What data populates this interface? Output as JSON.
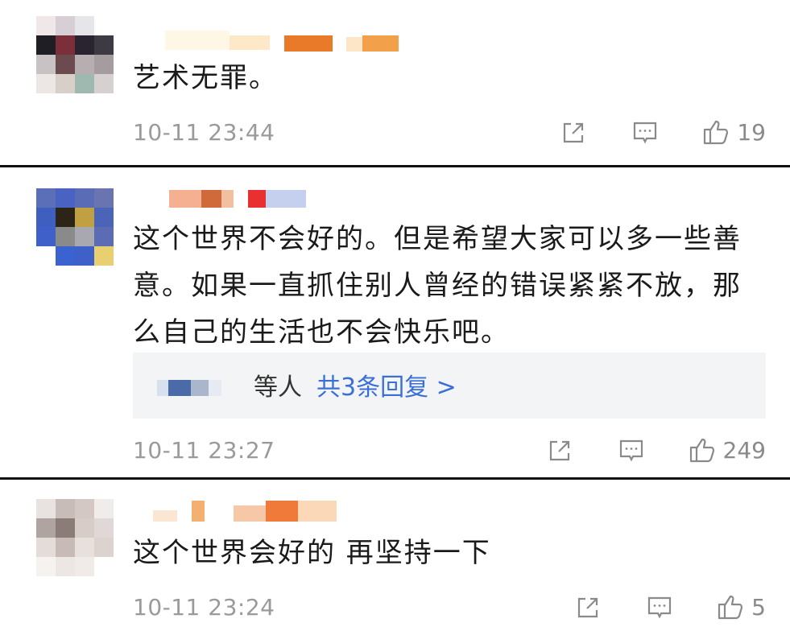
{
  "comments": [
    {
      "text": "艺术无罪。",
      "time": "10-11 23:44",
      "likes": "19"
    },
    {
      "text": "这个世界不会好的。但是希望大家可以多一些善意。如果一直抓住别人曾经的错误紧紧不放，那么自己的生活也不会快乐吧。",
      "time": "10-11 23:27",
      "likes": "249",
      "reply_prefix": "等人",
      "reply_link": "共3条回复 >"
    },
    {
      "text": "这个世界会好的 再坚持一下",
      "time": "10-11 23:24",
      "likes": "5"
    }
  ],
  "icons": {
    "share": "share-icon",
    "comment": "comment-icon",
    "like": "thumbs-up-icon"
  },
  "colors": {
    "link": "#3a6fd8",
    "meta": "#9a9a9a",
    "reply_bg": "#f3f4f6"
  }
}
